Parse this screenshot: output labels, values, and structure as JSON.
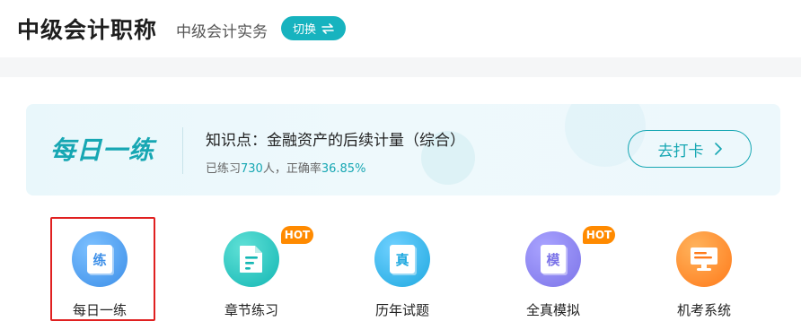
{
  "header": {
    "title": "中级会计职称",
    "subject": "中级会计实务",
    "switch_label": "切换"
  },
  "daily_banner": {
    "logo_text": "每日一练",
    "topic": "知识点：金融资产的后续计量（综合）",
    "stats_prefix": "已练习",
    "practiced_count": "730",
    "stats_middle": "人，正确率",
    "accuracy": "36.85%",
    "checkin_label": "去打卡",
    "accent_color": "#17a7b3"
  },
  "features": [
    {
      "label": "每日一练",
      "icon": "practice-icon",
      "glyph": "练",
      "hot": false,
      "color": "#3d8fe8",
      "selected": true
    },
    {
      "label": "章节练习",
      "icon": "chapter-icon",
      "glyph": "",
      "hot": true,
      "hot_label": "HOT",
      "color": "#14b7b4"
    },
    {
      "label": "历年试题",
      "icon": "past-exam-icon",
      "glyph": "真",
      "hot": false,
      "color": "#1fa9e0"
    },
    {
      "label": "全真模拟",
      "icon": "mock-exam-icon",
      "glyph": "模",
      "hot": true,
      "hot_label": "HOT",
      "color": "#7c74e8"
    },
    {
      "label": "机考系统",
      "icon": "computer-exam-icon",
      "glyph": "",
      "hot": false,
      "color": "#ff7a1a"
    }
  ]
}
